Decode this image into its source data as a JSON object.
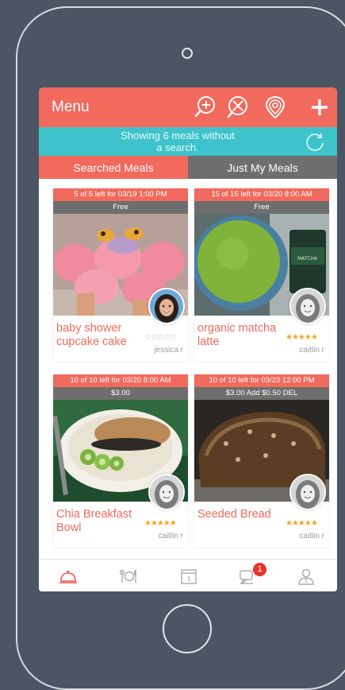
{
  "header": {
    "title": "Menu"
  },
  "banner": {
    "line1": "Showing 6 meals without",
    "line2": "a search."
  },
  "tabs": [
    {
      "label": "Searched Meals",
      "active": true
    },
    {
      "label": "Just My Meals",
      "active": false
    }
  ],
  "meals": [
    {
      "availability": "5 of 5 left for 03/19 1:00 PM",
      "price": "Free",
      "title": "baby shower cupcake cake",
      "author": "jessica r",
      "rating": 0
    },
    {
      "availability": "15 of 15 left for 03/20 8:00 AM",
      "price": "Free",
      "title": "organic matcha latte",
      "author": "caitlin r",
      "rating": 5
    },
    {
      "availability": "10 of 10 left for 03/20 8:00 AM",
      "price": "$3.00",
      "title": "Chia Breakfast Bowl",
      "author": "caitlin r",
      "rating": 5
    },
    {
      "availability": "10 of 10 left for 03/23 12:00 PM",
      "price": "$3.00 Add  $0.50 DEL",
      "title": "Seeded Bread",
      "author": "caitlin r",
      "rating": 5
    }
  ],
  "tabbar": {
    "notification_count": "1"
  },
  "colors": {
    "primary": "#f16a5d",
    "banner": "#3ec3cc",
    "gray": "#6e6e6e",
    "star": "#f5a623",
    "background": "#4c5564"
  }
}
